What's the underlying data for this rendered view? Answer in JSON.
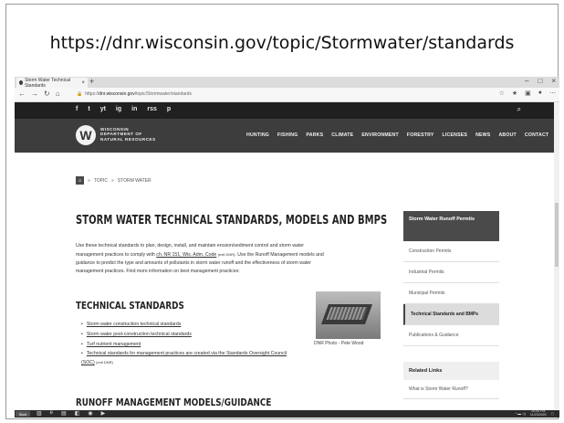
{
  "slide": {
    "url_heading": "https://dnr.wisconsin.gov/topic/Stormwater/standards"
  },
  "browser": {
    "tab_title": "Storm Water Technical Standards",
    "new_tab": "+",
    "url_prefix": "https://",
    "url_domain": "dnr.wisconsin.gov",
    "url_path": "/topic/Stormwater/standards",
    "window_controls": [
      "–",
      "□",
      "×"
    ],
    "nav_icons": [
      "←",
      "→",
      "↻",
      "⌂"
    ]
  },
  "site": {
    "social_icons": [
      "f",
      "t",
      "yt",
      "ig",
      "in",
      "rss",
      "p"
    ],
    "logo_letter": "W",
    "logo_lines": [
      "WISCONSIN",
      "DEPARTMENT OF",
      "NATURAL RESOURCES"
    ],
    "nav": [
      "HUNTING",
      "FISHING",
      "PARKS",
      "CLIMATE",
      "ENVIRONMENT",
      "FORESTRY",
      "LICENSES",
      "NEWS",
      "ABOUT",
      "CONTACT"
    ]
  },
  "breadcrumb": {
    "items": [
      "TOPIC",
      "STORM WATER"
    ],
    "separator": "»"
  },
  "main": {
    "title": "STORM WATER TECHNICAL STANDARDS, MODELS AND BMPS",
    "intro_1": "Use these technical standards to plan, design, install, and maintain erosion/sediment control and storm water management practices to comply with ",
    "intro_link": "ch. NR 151, Wis. Adm. Code",
    "intro_ext": "(exit DNR)",
    "intro_2": ". Use the Runoff Management models and guidance to predict the type and amounts of pollutants in storm water runoff and the effectiveness of storm water management practices. Find more information on best management practices:",
    "section_1": "TECHNICAL STANDARDS",
    "standards": [
      "Storm water construction technical standards",
      "Storm water post-construction technical standards",
      "Turf nutrient management",
      "Technical standards for management practices are created via the Standards Oversight Council (SOC)"
    ],
    "standards_ext": "(exit DNR)",
    "photo_caption": "DNR Photo - Pete Wood",
    "section_2": "RUNOFF MANAGEMENT MODELS/GUIDANCE"
  },
  "sidebar": {
    "heading": "Storm Water Runoff Permits",
    "items": [
      "Construction Permits",
      "Industrial Permits",
      "Municipal Permits",
      "Technical Standards and BMPs",
      "Publications & Guidance"
    ],
    "active_index": 3,
    "related_heading": "Related Links",
    "related_items": [
      "What is Storm Water Runoff?"
    ]
  },
  "taskbar": {
    "start_label": "Start",
    "time": "10:05 PM",
    "date": "11/23/2020"
  },
  "colors": {
    "nav_dark": "#3d3d3d",
    "social_bar": "#202020",
    "sidebar_head": "#4a4a4a"
  }
}
